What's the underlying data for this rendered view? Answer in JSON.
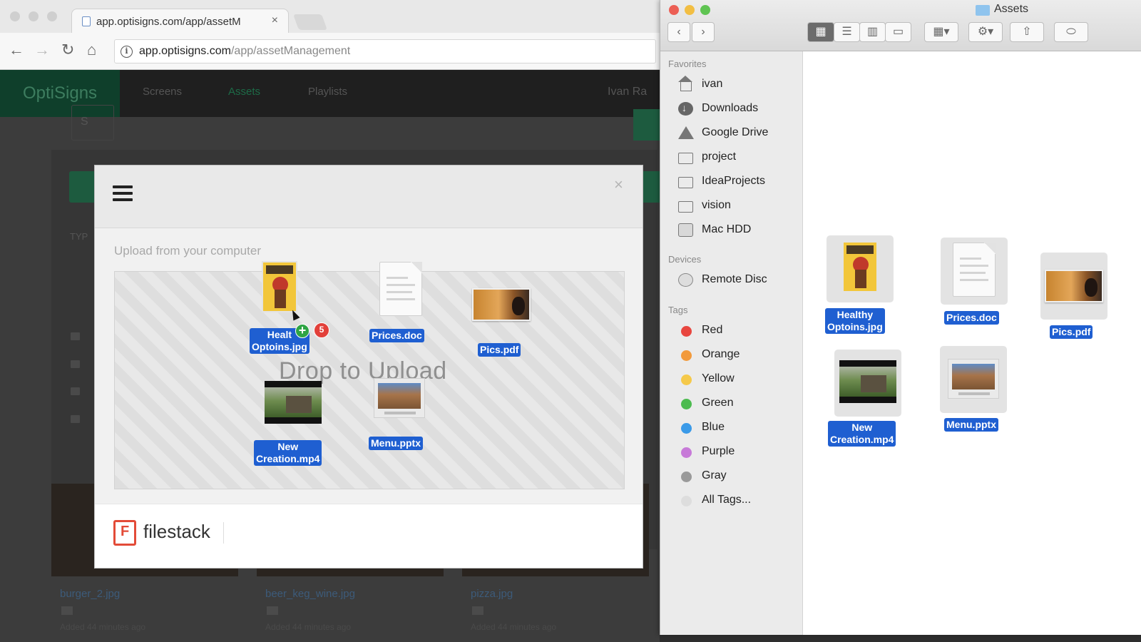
{
  "browser": {
    "tab_title": "app.optisigns.com/app/assetM",
    "tab_close": "×",
    "url_host": "app.optisigns.com",
    "url_path": "/app/assetManagement",
    "nav": {
      "back": "←",
      "forward": "→",
      "reload": "↻",
      "home": "⌂",
      "info": "i"
    }
  },
  "app": {
    "brand": "OptiSigns",
    "nav_links": [
      "Screens",
      "Assets",
      "Playlists"
    ],
    "user": "Ivan Ra",
    "search_stub": "S",
    "type_label": "TYP",
    "assets": [
      {
        "name": "burger_2.jpg",
        "added": "Added 44 minutes ago"
      },
      {
        "name": "beer_keg_wine.jpg",
        "added": "Added 44 minutes ago"
      },
      {
        "name": "pizza.jpg",
        "added": "Added 44 minutes ago"
      }
    ]
  },
  "modal": {
    "close": "×",
    "upload_label": "Upload from your computer",
    "drop_text": "Drop to Upload",
    "brand": "filestack",
    "brand_mark": "F",
    "drag_count": "5",
    "drag_plus": "+",
    "files": [
      {
        "label_line1": "Healt",
        "label_line2": "Optoins.jpg"
      },
      {
        "label_line1": "Prices.doc"
      },
      {
        "label_line1": "Pics.pdf"
      },
      {
        "label_line1": "New",
        "label_line2": "Creation.mp4"
      },
      {
        "label_line1": "Menu.pptx"
      }
    ]
  },
  "finder": {
    "title": "Assets",
    "toolbar": {
      "back": "‹",
      "forward": "›",
      "icon_view": "▦",
      "list_view": "☰",
      "column_view": "▥",
      "cover_view": "▭",
      "group": "▦▾",
      "action": "⚙▾",
      "share": "⇧",
      "tag": "⬭"
    },
    "sections": {
      "favorites": "Favorites",
      "devices": "Devices",
      "tags": "Tags"
    },
    "favorites": [
      "ivan",
      "Downloads",
      "Google Drive",
      "project",
      "IdeaProjects",
      "vision",
      "Mac HDD"
    ],
    "devices": [
      "Remote Disc"
    ],
    "tags": [
      {
        "label": "Red",
        "color": "#e8463f"
      },
      {
        "label": "Orange",
        "color": "#f29a3c"
      },
      {
        "label": "Yellow",
        "color": "#f5c94a"
      },
      {
        "label": "Green",
        "color": "#4cbb4f"
      },
      {
        "label": "Blue",
        "color": "#3a9ae8"
      },
      {
        "label": "Purple",
        "color": "#c77ad8"
      },
      {
        "label": "Gray",
        "color": "#9a9a9a"
      },
      {
        "label": "All Tags...",
        "color": "#dddddd"
      }
    ],
    "files": [
      {
        "line1": "Healthy",
        "line2": "Optoins.jpg"
      },
      {
        "line1": "Prices.doc"
      },
      {
        "line1": "Pics.pdf"
      },
      {
        "line1": "New",
        "line2": "Creation.mp4"
      },
      {
        "line1": "Menu.pptx"
      }
    ]
  }
}
